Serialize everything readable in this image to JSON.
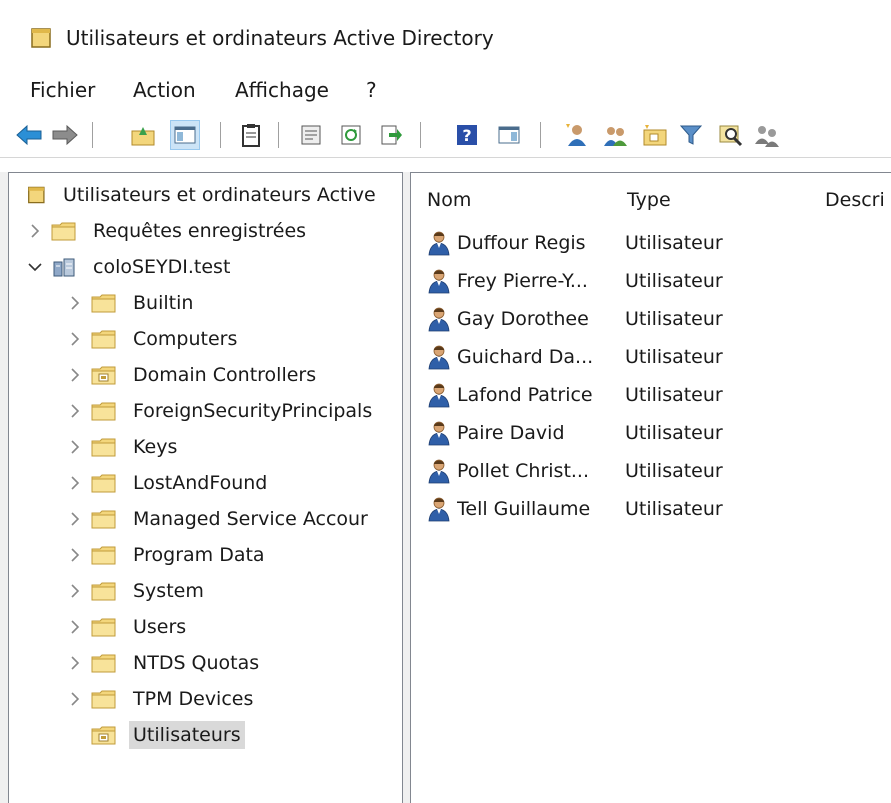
{
  "window": {
    "title": "Utilisateurs et ordinateurs Active Directory"
  },
  "menu": [
    {
      "id": "fichier",
      "label": "Fichier"
    },
    {
      "id": "action",
      "label": "Action"
    },
    {
      "id": "affichage",
      "label": "Affichage"
    },
    {
      "id": "help",
      "label": "?"
    }
  ],
  "toolbar": [
    {
      "name": "back-button",
      "icon": "back-arrow-icon"
    },
    {
      "name": "forward-button",
      "icon": "forward-arrow-icon"
    },
    {
      "name": "up-folder-button",
      "icon": "up-folder-icon"
    },
    {
      "name": "show-hide-tree-button",
      "icon": "console-tree-icon",
      "pressed": true
    },
    {
      "name": "clipboard-button",
      "icon": "clipboard-icon"
    },
    {
      "name": "properties-button",
      "icon": "properties-icon"
    },
    {
      "name": "refresh-button",
      "icon": "refresh-icon"
    },
    {
      "name": "export-list-button",
      "icon": "export-icon"
    },
    {
      "name": "help-button",
      "icon": "help-icon"
    },
    {
      "name": "action-pane-button",
      "icon": "action-pane-icon"
    },
    {
      "name": "new-user-button",
      "icon": "new-user-icon"
    },
    {
      "name": "new-group-button",
      "icon": "new-group-icon"
    },
    {
      "name": "new-ou-button",
      "icon": "new-ou-icon"
    },
    {
      "name": "filter-button",
      "icon": "filter-icon"
    },
    {
      "name": "find-button",
      "icon": "find-icon"
    },
    {
      "name": "add-to-group-button",
      "icon": "add-to-group-icon"
    }
  ],
  "tree": {
    "root": "Utilisateurs et ordinateurs Active",
    "saved_queries": "Requêtes enregistrées",
    "domain": "coloSEYDI.test",
    "children": [
      {
        "label": "Builtin",
        "icon": "folder-icon"
      },
      {
        "label": "Computers",
        "icon": "folder-icon"
      },
      {
        "label": "Domain Controllers",
        "icon": "ou-icon"
      },
      {
        "label": "ForeignSecurityPrincipals",
        "icon": "folder-icon"
      },
      {
        "label": "Keys",
        "icon": "folder-icon"
      },
      {
        "label": "LostAndFound",
        "icon": "folder-icon"
      },
      {
        "label": "Managed Service Accour",
        "icon": "folder-icon"
      },
      {
        "label": "Program Data",
        "icon": "folder-icon"
      },
      {
        "label": "System",
        "icon": "folder-icon"
      },
      {
        "label": "Users",
        "icon": "folder-icon"
      },
      {
        "label": "NTDS Quotas",
        "icon": "folder-icon"
      },
      {
        "label": "TPM Devices",
        "icon": "folder-icon"
      },
      {
        "label": "Utilisateurs",
        "icon": "ou-icon",
        "selected": true,
        "no_chevron": true
      }
    ]
  },
  "list": {
    "columns": [
      {
        "label": "Nom"
      },
      {
        "label": "Type"
      },
      {
        "label": "Descri"
      }
    ],
    "rows": [
      {
        "name": "Duffour Regis",
        "type": "Utilisateur"
      },
      {
        "name": "Frey Pierre-Y...",
        "type": "Utilisateur"
      },
      {
        "name": "Gay Dorothee",
        "type": "Utilisateur"
      },
      {
        "name": "Guichard Da...",
        "type": "Utilisateur"
      },
      {
        "name": "Lafond Patrice",
        "type": "Utilisateur"
      },
      {
        "name": "Paire David",
        "type": "Utilisateur"
      },
      {
        "name": "Pollet Christ...",
        "type": "Utilisateur"
      },
      {
        "name": "Tell Guillaume",
        "type": "Utilisateur"
      }
    ]
  },
  "colors": {
    "selection": "#d9d9d9",
    "folder": "#f3d67c",
    "back_arrow": "#2b8fd6"
  }
}
